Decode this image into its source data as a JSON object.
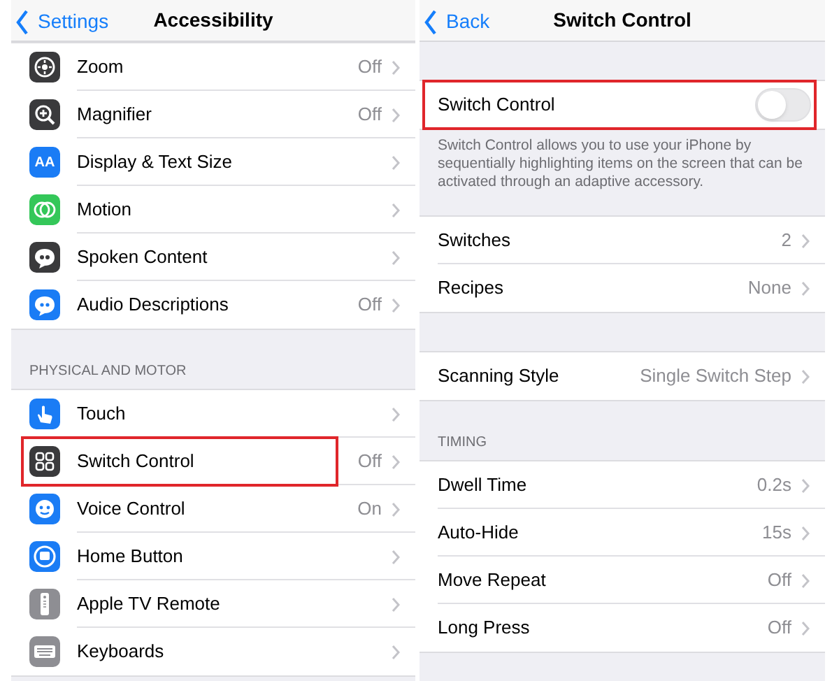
{
  "screens": [
    {
      "nav": {
        "back": "Settings",
        "title": "Accessibility"
      },
      "sections": [
        {
          "rows": [
            {
              "label": "Zoom",
              "value": "Off",
              "color": "#3a3a3c",
              "highlighted": false
            },
            {
              "label": "Magnifier",
              "value": "Off",
              "color": "#3a3a3c",
              "highlighted": false
            },
            {
              "label": "Display & Text Size",
              "color": "#1a7cf5",
              "icon_text": "AA",
              "highlighted": false
            },
            {
              "label": "Motion",
              "color": "#34c759",
              "highlighted": false
            },
            {
              "label": "Spoken Content",
              "color": "#3a3a3c",
              "highlighted": false
            },
            {
              "label": "Audio Descriptions",
              "value": "Off",
              "color": "#1a7cf5",
              "highlighted": false
            }
          ]
        },
        {
          "header": "PHYSICAL AND MOTOR",
          "rows": [
            {
              "label": "Touch",
              "color": "#1a7cf5",
              "highlighted": false
            },
            {
              "label": "Switch Control",
              "value": "Off",
              "color": "#3a3a3c",
              "highlighted": true
            },
            {
              "label": "Voice Control",
              "value": "On",
              "color": "#1a7cf5",
              "highlighted": false
            },
            {
              "label": "Home Button",
              "color": "#1a7cf5",
              "highlighted": false
            },
            {
              "label": "Apple TV Remote",
              "color": "#8e8e93",
              "highlighted": false
            },
            {
              "label": "Keyboards",
              "color": "#8e8e93",
              "highlighted": false
            }
          ]
        }
      ]
    },
    {
      "nav": {
        "back": "Back",
        "title": "Switch Control"
      },
      "sections": [
        {
          "rows": [
            {
              "kind": "toggle",
              "label": "Switch Control",
              "on": false,
              "highlighted": true
            }
          ],
          "footer": "Switch Control allows you to use your iPhone by sequentially highlighting items on the screen that can be activated through an adaptive accessory."
        },
        {
          "rows": [
            {
              "kind": "disclosure",
              "label": "Switches",
              "value": "2",
              "highlighted": false
            },
            {
              "kind": "disclosure",
              "label": "Recipes",
              "value": "None",
              "highlighted": false
            }
          ]
        },
        {
          "rows": [
            {
              "kind": "disclosure",
              "label": "Scanning Style",
              "value": "Single Switch Step",
              "highlighted": false
            }
          ]
        },
        {
          "header": "TIMING",
          "rows": [
            {
              "kind": "disclosure",
              "label": "Dwell Time",
              "value": "0.2s",
              "highlighted": false
            },
            {
              "kind": "disclosure",
              "label": "Auto-Hide",
              "value": "15s",
              "highlighted": false
            },
            {
              "kind": "disclosure",
              "label": "Move Repeat",
              "value": "Off",
              "highlighted": false
            },
            {
              "kind": "disclosure",
              "label": "Long Press",
              "value": "Off",
              "highlighted": false
            }
          ]
        }
      ]
    }
  ]
}
